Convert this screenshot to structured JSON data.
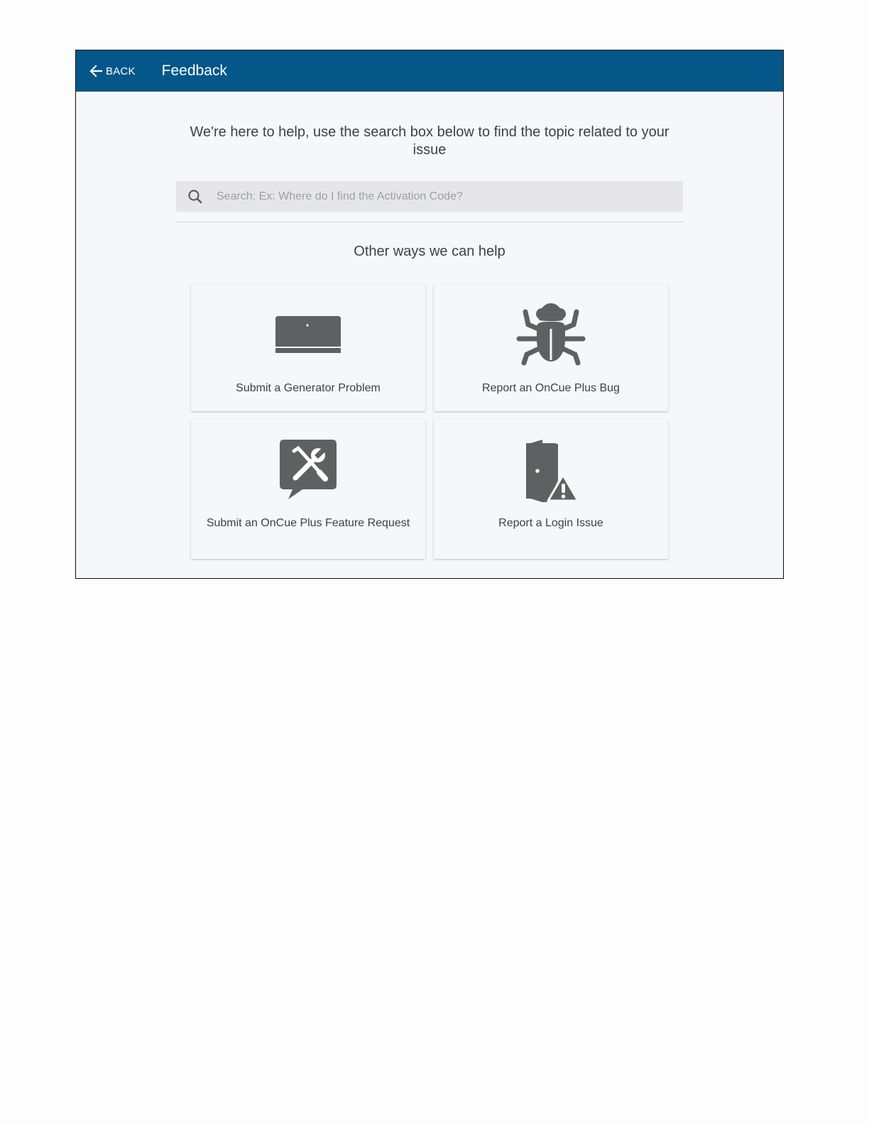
{
  "header": {
    "back_label": "BACK",
    "title": "Feedback",
    "background": "#035789"
  },
  "main": {
    "intro_text": "We're here to help, use the search box below to find the topic related to your issue",
    "search": {
      "placeholder": "Search: Ex: Where do I find the Activation Code?",
      "value": ""
    },
    "other_heading": "Other ways we can help",
    "cards": [
      {
        "label": "Submit a Generator Problem",
        "icon": "generator-icon"
      },
      {
        "label": "Report an OnCue Plus Bug",
        "icon": "bug-icon"
      },
      {
        "label": "Submit an OnCue Plus Feature Request",
        "icon": "tools-chat-icon"
      },
      {
        "label": "Report a Login Issue",
        "icon": "door-warning-icon"
      }
    ]
  },
  "colors": {
    "icon": "#5f6062",
    "text": "#3c4248",
    "background": "#f5f7fa"
  }
}
